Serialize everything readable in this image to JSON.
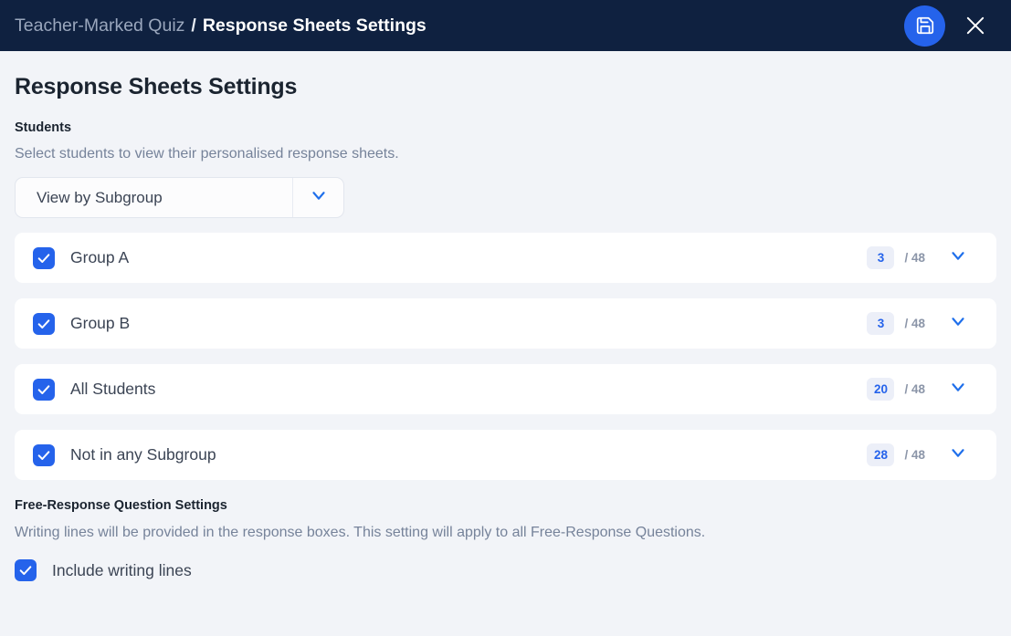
{
  "header": {
    "breadcrumb_parent": "Teacher-Marked Quiz",
    "breadcrumb_separator": "/",
    "breadcrumb_current": "Response Sheets Settings",
    "save_icon": "save-floppy-disk-icon",
    "close_icon": "close-x-icon",
    "background_color": "#0f2140",
    "accent_color": "#2563eb"
  },
  "main": {
    "page_title": "Response Sheets Settings",
    "students_section": {
      "label": "Students",
      "description": "Select students to view their personalised response sheets.",
      "view_select": {
        "value": "View by Subgroup",
        "chevron_icon": "chevron-down-icon"
      },
      "rows": [
        {
          "label": "Group A",
          "checked": true,
          "selected_count": "3",
          "total_count": "/ 48",
          "chevron_icon": "chevron-down-icon"
        },
        {
          "label": "Group B",
          "checked": true,
          "selected_count": "3",
          "total_count": "/ 48",
          "chevron_icon": "chevron-down-icon"
        },
        {
          "label": "All Students",
          "checked": true,
          "selected_count": "20",
          "total_count": "/ 48",
          "chevron_icon": "chevron-down-icon"
        },
        {
          "label": "Not in any Subgroup",
          "checked": true,
          "selected_count": "28",
          "total_count": "/ 48",
          "chevron_icon": "chevron-down-icon"
        }
      ]
    },
    "free_response_section": {
      "label": "Free-Response Question Settings",
      "description": "Writing lines will be provided in the response boxes. This setting will apply to all Free-Response Questions.",
      "writing_lines": {
        "label": "Include writing lines",
        "checked": true
      }
    }
  },
  "colors": {
    "page_background": "#f2f4f8",
    "card_background": "#ffffff",
    "accent_blue": "#2563eb",
    "muted_text": "#76839a",
    "badge_background": "#eceff8"
  }
}
